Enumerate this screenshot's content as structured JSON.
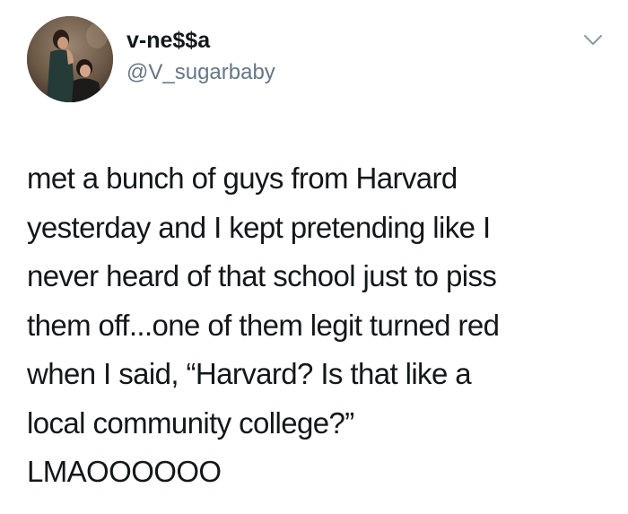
{
  "user": {
    "display_name": "v-ne$$a",
    "handle": "@V_sugarbaby"
  },
  "icons": {
    "avatar": "profile-photo",
    "menu": "chevron-down-icon"
  },
  "tweet": {
    "lines": [
      "met a bunch of guys from Harvard",
      "yesterday and I kept pretending like I",
      "never heard of that school just to piss",
      "them off...one of them legit turned red",
      "when I said, “Harvard? Is that like a",
      "local community college?”",
      "LMAOOOOOO"
    ]
  },
  "colors": {
    "text": "#14171a",
    "secondary_text": "#657786",
    "chevron": "#8899a6",
    "background": "#ffffff"
  }
}
